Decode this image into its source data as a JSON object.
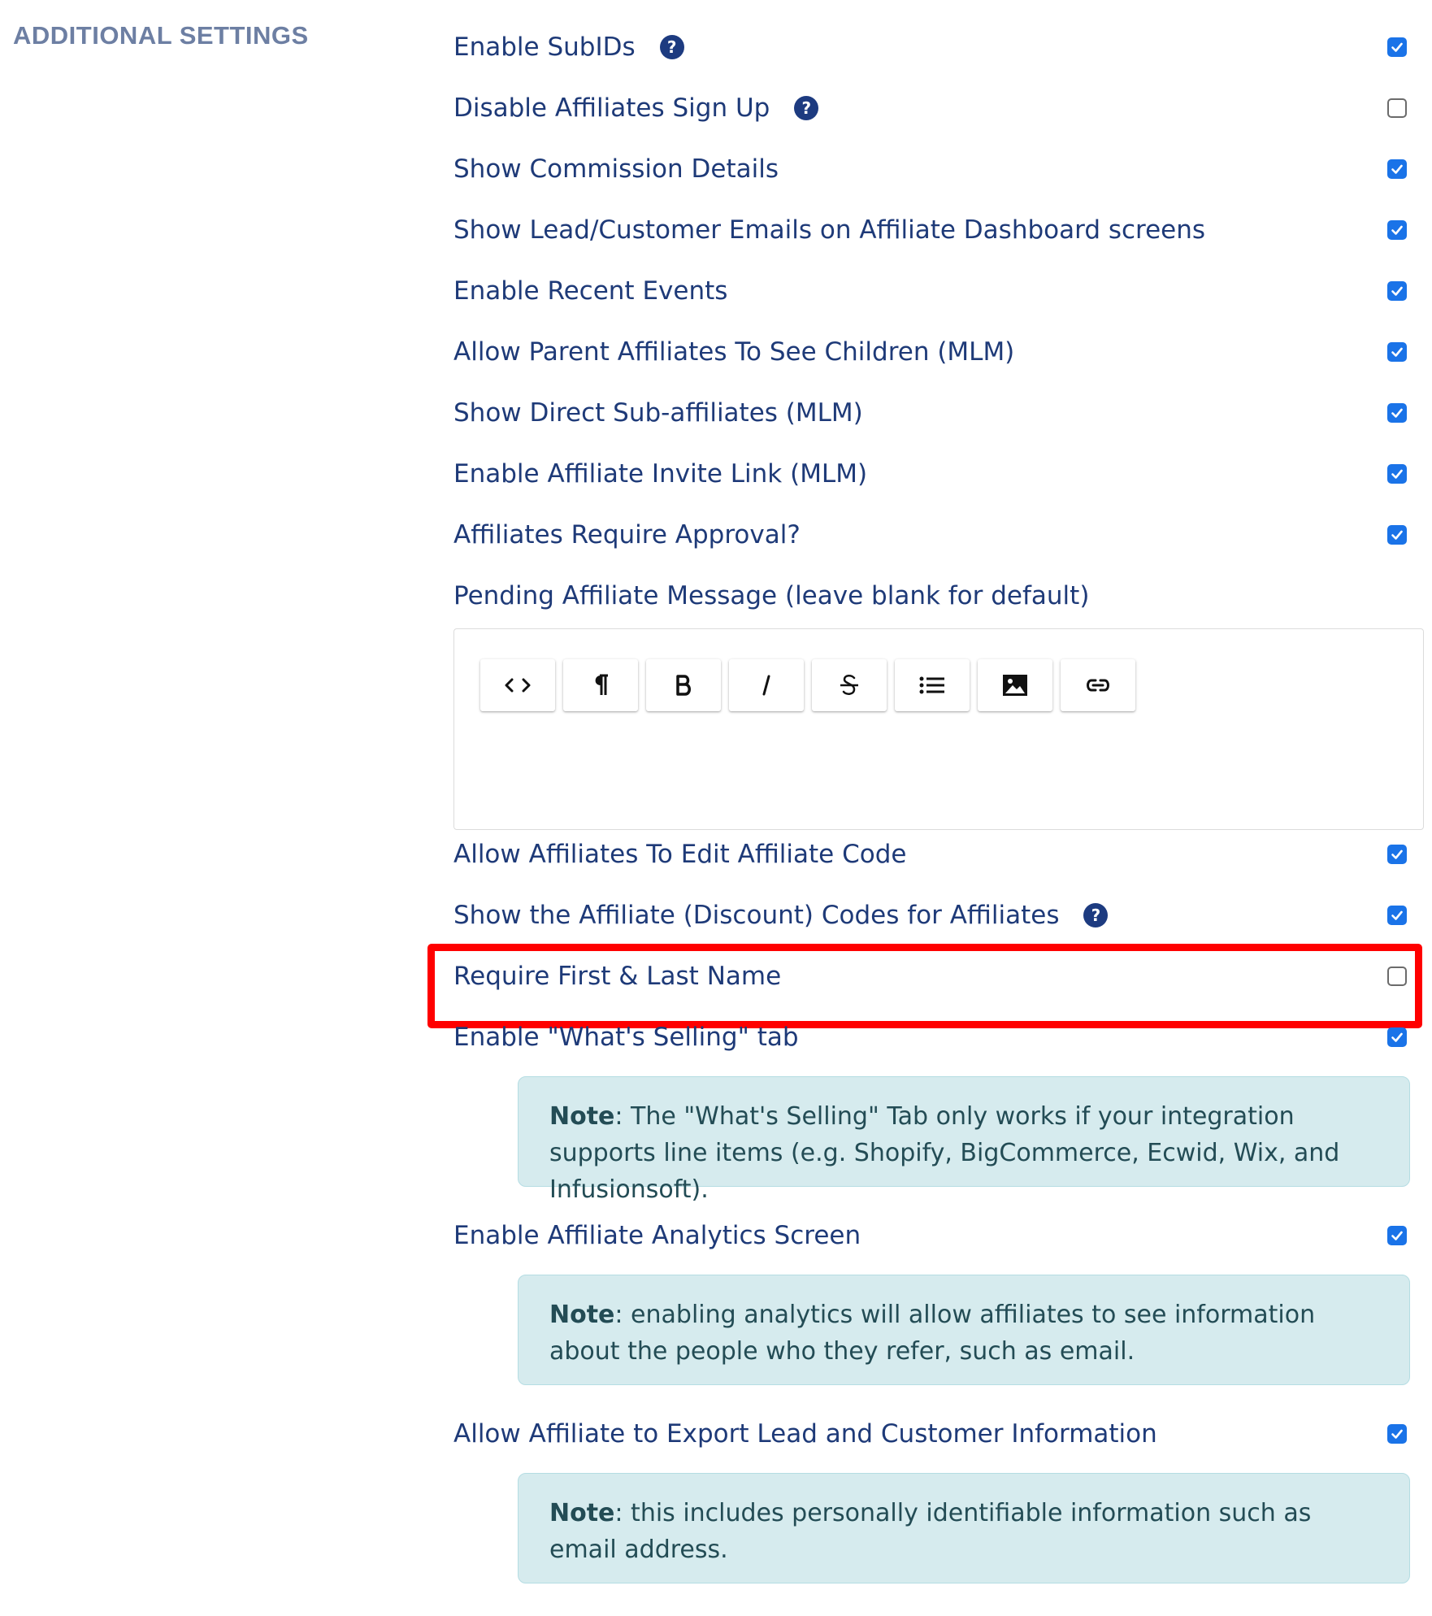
{
  "section_title": "ADDITIONAL SETTINGS",
  "settings": [
    {
      "label": "Enable SubIDs",
      "checked": true,
      "help": true
    },
    {
      "label": "Disable Affiliates Sign Up",
      "checked": false,
      "help": true
    },
    {
      "label": "Show Commission Details",
      "checked": true,
      "help": false
    },
    {
      "label": "Show Lead/Customer Emails on Affiliate Dashboard screens",
      "checked": true,
      "help": false
    },
    {
      "label": "Enable Recent Events",
      "checked": true,
      "help": false
    },
    {
      "label": "Allow Parent Affiliates To See Children (MLM)",
      "checked": true,
      "help": false
    },
    {
      "label": "Show Direct Sub-affiliates (MLM)",
      "checked": true,
      "help": false
    },
    {
      "label": "Enable Affiliate Invite Link (MLM)",
      "checked": true,
      "help": false
    },
    {
      "label": "Affiliates Require Approval?",
      "checked": true,
      "help": false
    },
    {
      "label": "Allow Affiliates To Edit Affiliate Code",
      "checked": true,
      "help": false
    },
    {
      "label": "Show the Affiliate (Discount) Codes for Affiliates",
      "checked": true,
      "help": true
    },
    {
      "label": "Require First & Last Name",
      "checked": false,
      "help": false
    },
    {
      "label": "Enable \"What's Selling\" tab",
      "checked": true,
      "help": false
    },
    {
      "label": "Enable Affiliate Analytics Screen",
      "checked": true,
      "help": false
    },
    {
      "label": "Allow Affiliate to Export Lead and Customer Information",
      "checked": true,
      "help": false
    }
  ],
  "pending_message": {
    "label": "Pending Affiliate Message (leave blank for default)",
    "value": ""
  },
  "editor_toolbar": [
    {
      "icon": "code-icon"
    },
    {
      "icon": "paragraph-icon"
    },
    {
      "icon": "bold-icon"
    },
    {
      "icon": "italic-icon"
    },
    {
      "icon": "strikethrough-icon"
    },
    {
      "icon": "list-icon"
    },
    {
      "icon": "image-icon"
    },
    {
      "icon": "link-icon"
    }
  ],
  "notes": {
    "whats_selling": {
      "bold": "Note",
      "text": ": The \"What's Selling\" Tab only works if your integration supports line items (e.g. Shopify, BigCommerce, Ecwid, Wix, and Infusionsoft)."
    },
    "analytics": {
      "bold": "Note",
      "text": ": enabling analytics will allow affiliates to see information about the people who they refer, such as email."
    },
    "export": {
      "bold": "Note",
      "text": ": this includes personally identifiable information such as email address."
    }
  },
  "highlight": {
    "target": "Require First & Last Name",
    "color": "#ff0000"
  },
  "colors": {
    "label_text": "#1e3a78",
    "section_title": "#6d7fa3",
    "checkbox_checked": "#1a73e8",
    "note_background": "#d6ebee",
    "note_text": "#234c55"
  }
}
